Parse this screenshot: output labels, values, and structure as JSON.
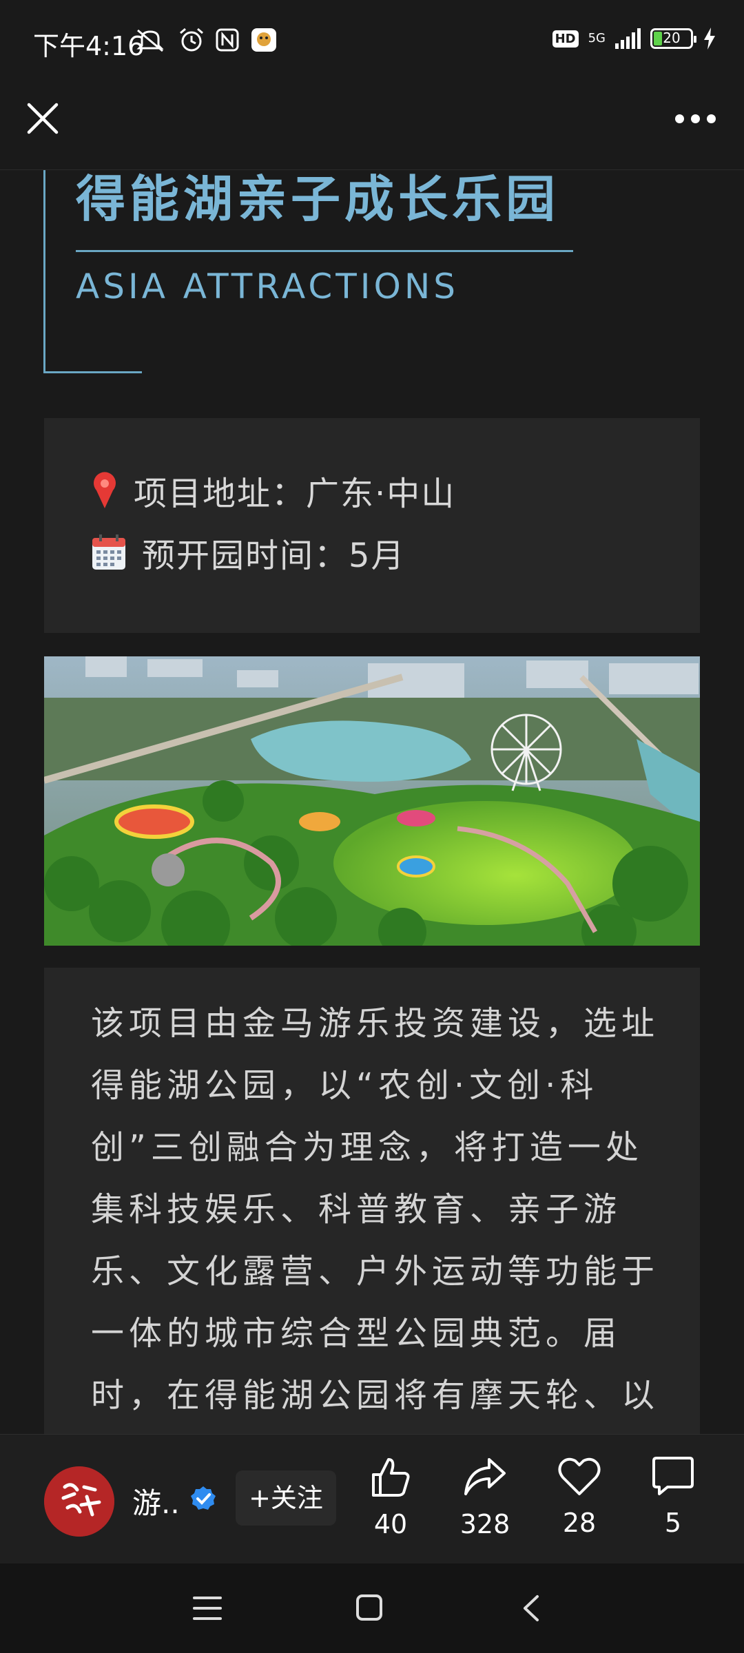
{
  "status_bar": {
    "time": "下午4:16",
    "network": "5G",
    "hd_badge": "HD",
    "battery": "20"
  },
  "article": {
    "title_zh": "得能湖亲子成长乐园",
    "title_en": "ASIA ATTRACTIONS",
    "address_line": "项目地址：广东·中山",
    "opening_line": "预开园时间：5月",
    "paragraph": "该项目由金马游乐投资建设，选址得能湖公园，以“农创·文创·科创”三创融合为理念，将打造一处集科技娱乐、科普教育、亲子游乐、文化露营、户外运动等功能于一体的城市综合型公园典范。届时，在得能湖公园将有摩天轮、以绿植生态"
  },
  "action_bar": {
    "author_name": "游..",
    "follow_label": "+关注",
    "like_count": "40",
    "share_count": "328",
    "favorite_count": "28",
    "comment_count": "5"
  },
  "colors": {
    "accent_title": "#7ab6d6",
    "background": "#1a1a1a",
    "card": "#262626",
    "verified": "#2f8cf0"
  }
}
